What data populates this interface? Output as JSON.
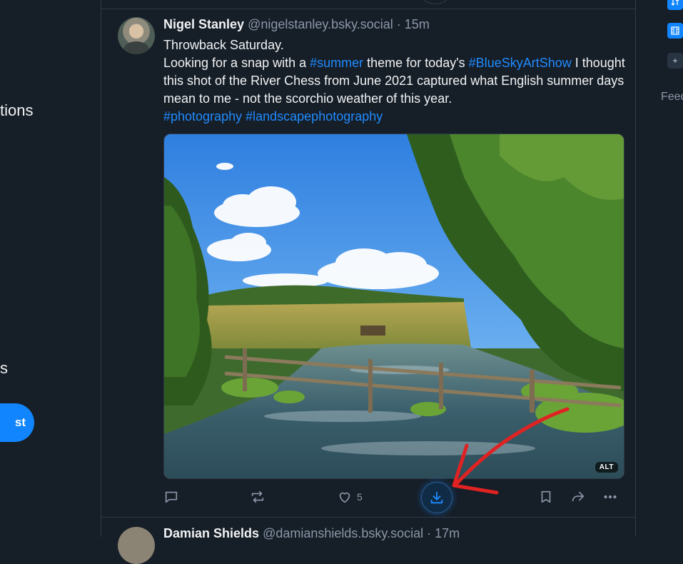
{
  "left_sidebar": {
    "notifications_fragment": "tions",
    "lists_fragment": "s",
    "new_post_fragment": "st"
  },
  "post": {
    "author": "Nigel Stanley",
    "handle": "@nigelstanley.bsky.social",
    "separator": "·",
    "time": "15m",
    "line1": "Throwback Saturday.",
    "line2_part1": "Looking for a snap with a ",
    "hashtag_summer": "#summer",
    "line2_part2": " theme for today's ",
    "hashtag_blueskyartshow": "#BlueSkyArtShow",
    "line2_part3": " I thought this shot of the River Chess from June 2021 captured what English summer days mean to me - not the scorchio weather of this year.",
    "hashtag_photography": "#photography",
    "hashtag_landscape": "#landscapephotography",
    "alt_badge": "ALT",
    "like_count": "5"
  },
  "icons": {
    "reply": "reply-icon",
    "repost": "repost-icon",
    "like": "heart-icon",
    "download": "download-icon",
    "bookmark": "bookmark-icon",
    "share": "share-icon",
    "more": "more-icon"
  },
  "next_post": {
    "author": "Damian Shields",
    "handle": "@damianshields.bsky.social",
    "separator": "·",
    "time": "17m"
  },
  "right_sidebar": {
    "add_icon": "+",
    "feeds_fragment": "Feed"
  },
  "colors": {
    "background": "#161e27",
    "accent": "#208bfe",
    "annotation_arrow": "#e02222"
  }
}
